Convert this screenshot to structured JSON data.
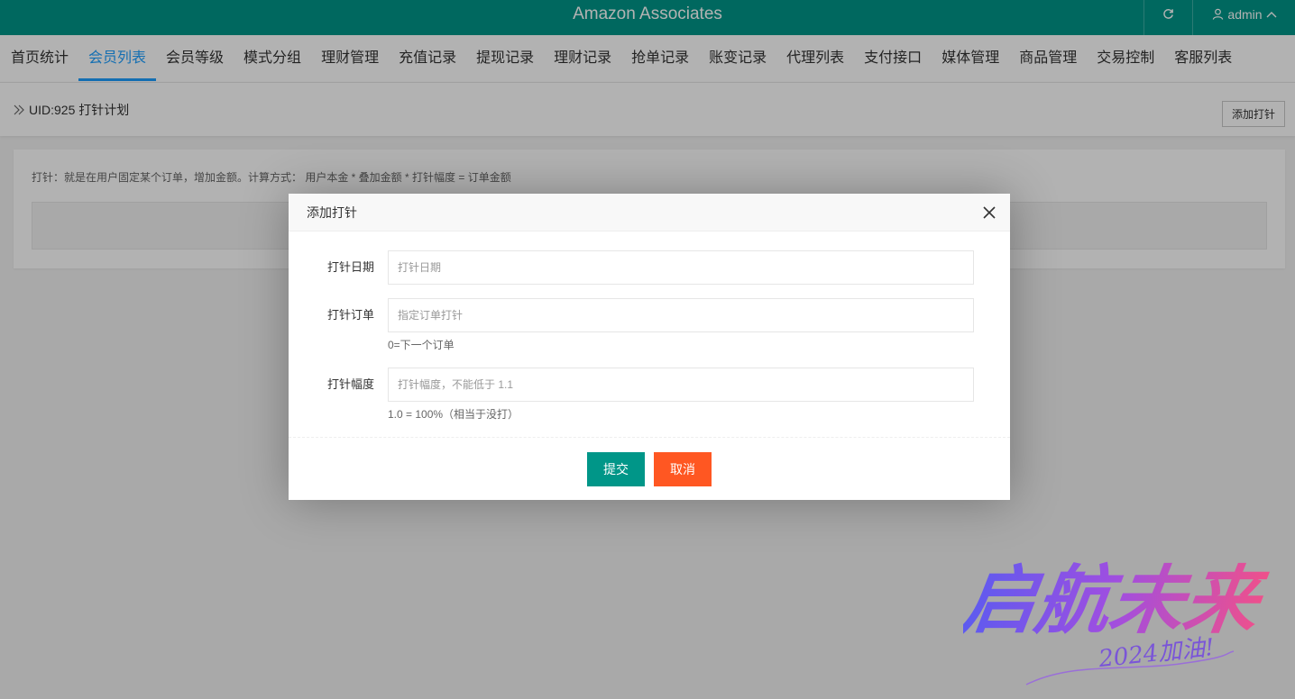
{
  "header": {
    "brand": "Amazon Associates",
    "user": "admin"
  },
  "nav": {
    "items": [
      "首页统计",
      "会员列表",
      "会员等级",
      "模式分组",
      "理财管理",
      "充值记录",
      "提现记录",
      "理财记录",
      "抢单记录",
      "账变记录",
      "代理列表",
      "支付接口",
      "媒体管理",
      "商品管理",
      "交易控制",
      "客服列表"
    ],
    "active_index": 1
  },
  "subheader": {
    "title": "UID:925 打针计划",
    "add_button": "添加打针"
  },
  "card": {
    "note": "打针：就是在用户固定某个订单，增加金额。计算方式： 用户本金 * 叠加金额 * 打针幅度 = 订单金额"
  },
  "modal": {
    "title": "添加打针",
    "fields": {
      "date": {
        "label": "打针日期",
        "placeholder": "打针日期",
        "value": ""
      },
      "order": {
        "label": "打针订单",
        "placeholder": "指定订单打针",
        "value": "",
        "hint": "0=下一个订单"
      },
      "range": {
        "label": "打针幅度",
        "placeholder": "打针幅度，不能低于 1.1",
        "value": "",
        "hint": "1.0 = 100%（相当于没打）"
      }
    },
    "submit": "提交",
    "cancel": "取消"
  },
  "watermark": {
    "main": "启航未来",
    "sub": "2024加油!"
  },
  "colors": {
    "primary": "#009688",
    "nav_active": "#1E9FFF",
    "danger": "#FF5722"
  }
}
